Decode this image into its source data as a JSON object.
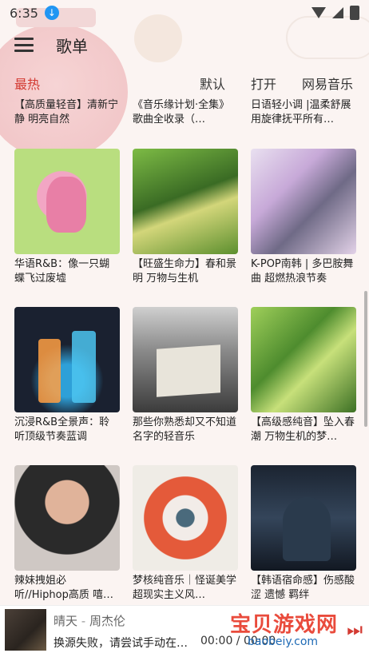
{
  "status_bar": {
    "time": "6:35"
  },
  "app_bar": {
    "title": "歌单"
  },
  "tabs": [
    {
      "label": "最热"
    },
    {
      "label": "默认"
    },
    {
      "label": "打开"
    },
    {
      "label": "网易音乐"
    }
  ],
  "playlists": [
    {
      "title": "【高质量轻音】清新宁静 明亮自然"
    },
    {
      "title": "《音乐缘计划·全集》歌曲全收录（…"
    },
    {
      "title": "日语轻小调 |温柔舒展 用旋律抚平所有…"
    },
    {
      "title": "华语R&B：像一只蝴蝶飞过废墟"
    },
    {
      "title": "【旺盛生命力】春和景明 万物与生机"
    },
    {
      "title": "K-POP南韩 | 多巴胺舞曲 超燃热浪节奏"
    },
    {
      "title": "沉浸R&B全景声：聆听顶级节奏蓝调"
    },
    {
      "title": "那些你熟悉却又不知道名字的轻音乐"
    },
    {
      "title": "【高级感纯音】坠入春潮 万物生机的梦…"
    },
    {
      "title": "辣妹拽姐必听//Hiphop高质 嘻哈说…"
    },
    {
      "title": "梦核纯音乐｜怪诞美学 超现实主义风…"
    },
    {
      "title": "【韩语宿命感】伤感酸涩 遗憾 羁绊"
    }
  ],
  "player": {
    "song": "晴天",
    "artist": "周杰伦",
    "message": "换源失败，请尝试手动在搜索…",
    "time": "00:00 / 00:00"
  },
  "watermark": {
    "text": "宝贝游戏网",
    "url": "baobeiy.com"
  },
  "colors": {
    "accent": "#d33a32"
  }
}
